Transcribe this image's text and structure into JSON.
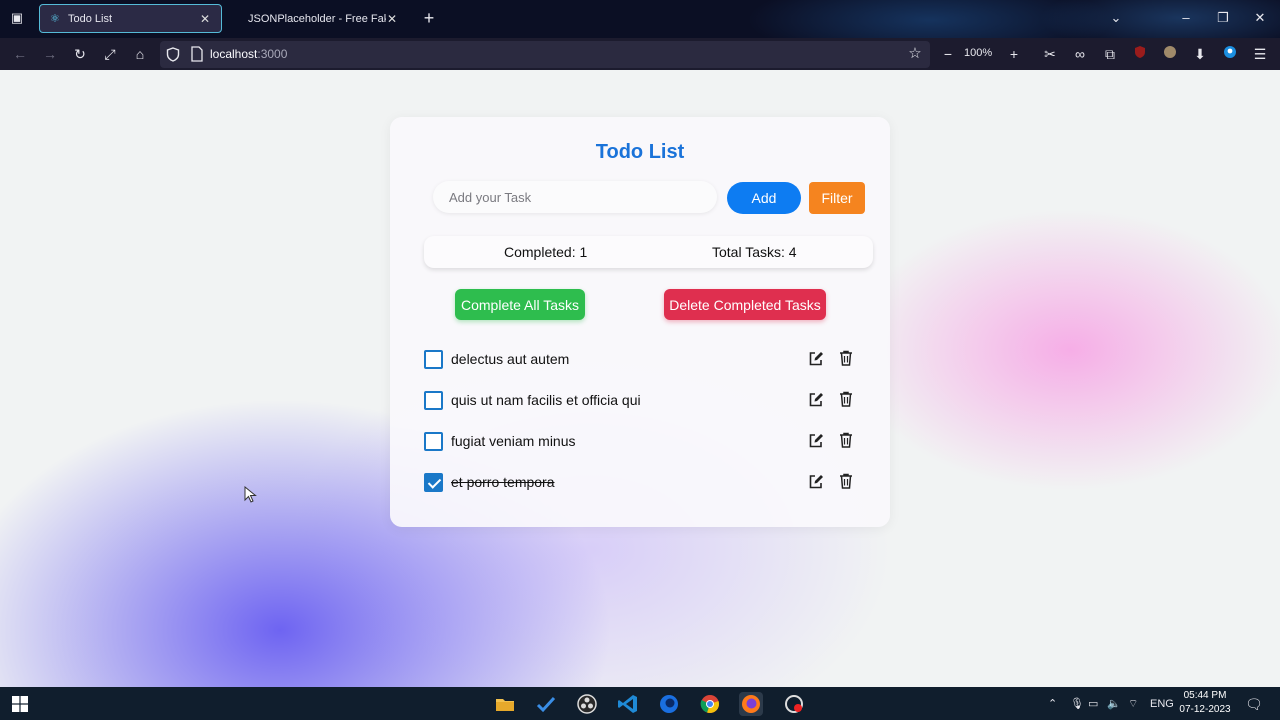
{
  "browser": {
    "tabs": [
      {
        "title": "Todo List",
        "active": true
      },
      {
        "title": "JSONPlaceholder - Free Fake RE",
        "active": false
      }
    ],
    "url_host": "localhost",
    "url_port": ":3000",
    "zoom": "100%"
  },
  "app": {
    "title": "Todo List",
    "input_placeholder": "Add your Task",
    "add_label": "Add",
    "filter_label": "Filter",
    "completed_label": "Completed: 1",
    "total_label": "Total Tasks: 4",
    "complete_all_label": "Complete All Tasks",
    "delete_completed_label": "Delete Completed Tasks",
    "tasks": [
      {
        "text": "delectus aut autem",
        "completed": false
      },
      {
        "text": "quis ut nam facilis et officia qui",
        "completed": false
      },
      {
        "text": "fugiat veniam minus",
        "completed": false
      },
      {
        "text": "et porro tempora",
        "completed": true
      }
    ],
    "accent_color": "#1a73d9"
  },
  "taskbar": {
    "language": "ENG",
    "time": "05:44 PM",
    "date": "07-12-2023"
  }
}
